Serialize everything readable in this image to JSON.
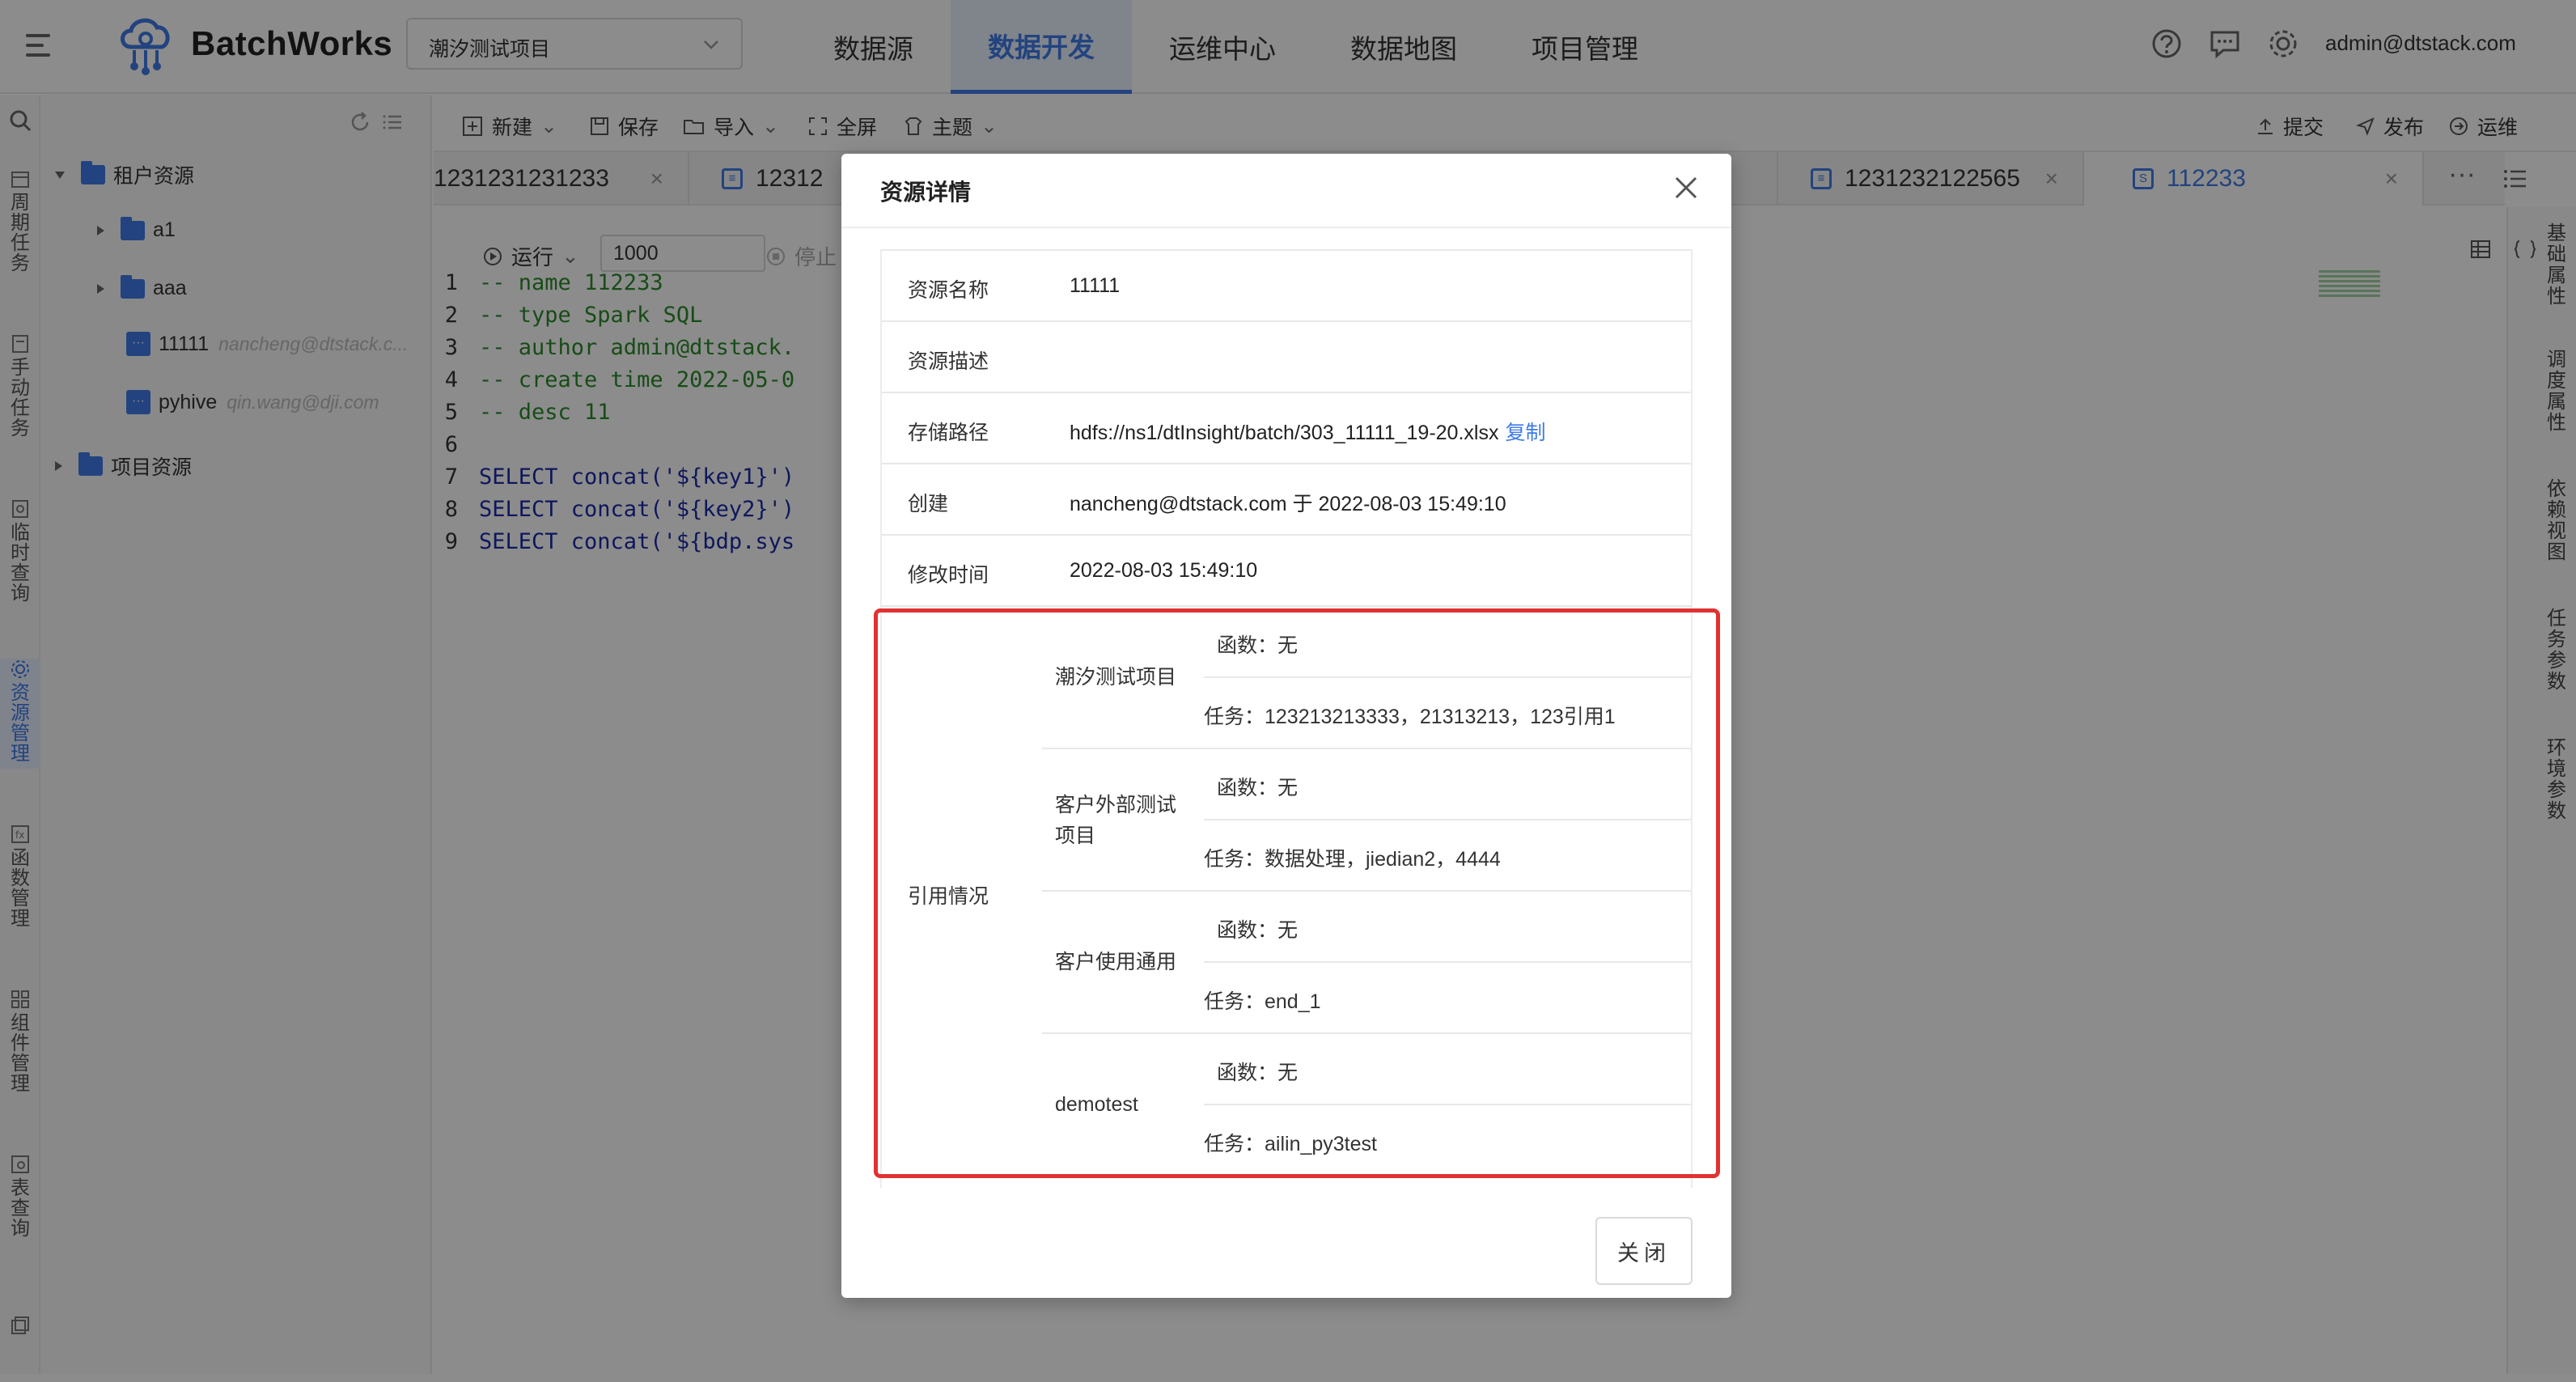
{
  "app": {
    "name": "BatchWorks"
  },
  "header": {
    "project": "潮汐测试项目",
    "nav": [
      "数据源",
      "数据开发",
      "运维中心",
      "数据地图",
      "项目管理"
    ],
    "active_nav": "数据开发",
    "user": "admin@dtstack.com"
  },
  "left_bar": {
    "items": [
      {
        "label": "周期任务",
        "icon": "calendar-icon"
      },
      {
        "label": "手动任务",
        "icon": "manual-task-icon"
      },
      {
        "label": "临时查询",
        "icon": "query-icon"
      },
      {
        "label": "资源管理",
        "icon": "gear-icon"
      },
      {
        "label": "函数管理",
        "icon": "function-icon"
      },
      {
        "label": "组件管理",
        "icon": "component-icon"
      },
      {
        "label": "表查询",
        "icon": "table-query-icon"
      }
    ]
  },
  "tree": {
    "items": [
      {
        "label": "租户资源"
      },
      {
        "label": "a1"
      },
      {
        "label": "aaa"
      },
      {
        "label": "11111",
        "owner": "nancheng@dtstack.c..."
      },
      {
        "label": "pyhive",
        "owner": "qin.wang@dji.com"
      },
      {
        "label": "项目资源"
      }
    ]
  },
  "toolbar": {
    "new": "新建",
    "save": "保存",
    "import": "导入",
    "fullscreen": "全屏",
    "theme": "主题",
    "submit": "提交",
    "publish": "发布",
    "ops": "运维"
  },
  "tabs": [
    "1231231231233",
    "12312",
    "1231232122565",
    "112233"
  ],
  "editor": {
    "run": "运行",
    "limit": "1000",
    "stop": "停止",
    "lines": [
      "-- name 112233",
      "-- type Spark SQL",
      "-- author admin@dtstack.",
      "-- create time 2022-05-0",
      "-- desc 11",
      "",
      "SELECT concat('${key1}')",
      "SELECT concat('${key2}')",
      "SELECT concat('${bdp.sys"
    ]
  },
  "right_strip": [
    "基础属性",
    "调度属性",
    "依赖视图",
    "任务参数",
    "环境参数"
  ],
  "modal": {
    "title": "资源详情",
    "rows": [
      {
        "key": "资源名称",
        "value": "11111"
      },
      {
        "key": "资源描述",
        "value": ""
      },
      {
        "key": "存储路径",
        "value": "hdfs://ns1/dtInsight/batch/303_11111_19-20.xlsx"
      },
      {
        "key": "创建",
        "value": "nancheng@dtstack.com 于 2022-08-03 15:49:10"
      },
      {
        "key": "修改时间",
        "value": "2022-08-03 15:49:10"
      }
    ],
    "copy": "复制",
    "ref_label": "引用情况",
    "references": [
      {
        "project": "潮汐测试项目",
        "func": "函数：无",
        "task": "任务：123213213333，21313213，123引用1"
      },
      {
        "project": "客户外部测试项目",
        "func": "函数：无",
        "task": "任务：数据处理，jiedian2，4444"
      },
      {
        "project": "客户使用通用",
        "func": "函数：无",
        "task": "任务：end_1"
      },
      {
        "project": "demotest",
        "func": "函数：无",
        "task": "任务：ailin_py3test"
      }
    ],
    "close": "关闭"
  },
  "colors": {
    "accent": "#3f7be8",
    "highlight": "#e03232"
  }
}
